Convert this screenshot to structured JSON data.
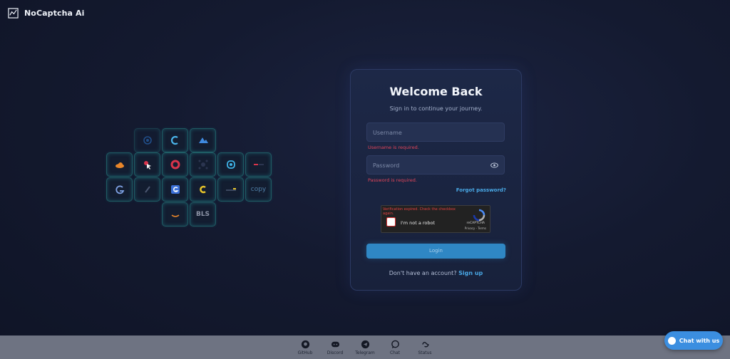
{
  "brand": {
    "name": "NoCaptcha Ai"
  },
  "login": {
    "title": "Welcome Back",
    "subtitle": "Sign in to continue your journey.",
    "username_placeholder": "Username",
    "username_error": "Username is required.",
    "password_placeholder": "Password",
    "password_error": "Password is required.",
    "forgot": "Forgot password?",
    "captcha": {
      "warning": "Verification expired. Check the checkbox again.",
      "label": "I'm not a robot",
      "brand": "reCAPTCHA",
      "terms": "Privacy - Terms"
    },
    "login_button": "Login",
    "signup_prompt": "Don't have an account?",
    "signup_link": "Sign up"
  },
  "tiles": {
    "copy": "copy",
    "bls": "BLS"
  },
  "footer": {
    "items": [
      "GitHub",
      "Discord",
      "Telegram",
      "Chat",
      "Status"
    ]
  },
  "chat_widget": {
    "label": "Chat with us"
  },
  "colors": {
    "accent": "#49a8e6",
    "button": "#2f87c4",
    "error": "#e0455a",
    "background": "#141a30"
  }
}
